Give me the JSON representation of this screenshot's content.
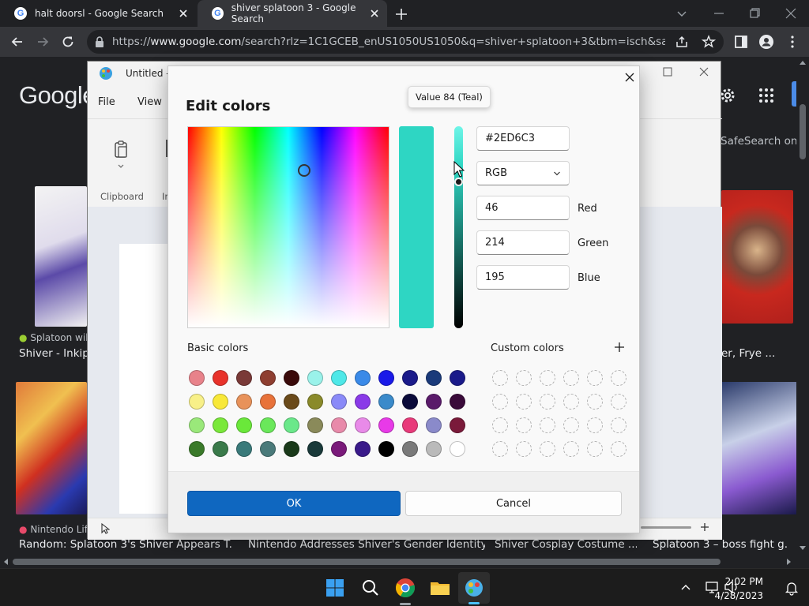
{
  "browser": {
    "tabs": [
      {
        "title": "halt doorsl - Google Search",
        "active": false
      },
      {
        "title": "shiver splatoon 3 - Google Search",
        "active": true
      }
    ],
    "url_prefix": "https://",
    "url_domain": "www.google.com",
    "url_rest": "/search?rlz=1C1GCEB_enUS1050US1050&q=shiver+splatoon+3&tbm=isch&sa=X&ved..."
  },
  "google": {
    "logo": "Google",
    "safesearch": "SafeSearch on",
    "results": [
      {
        "source": "Splatoon wik",
        "caption": "Shiver - Inkipe"
      },
      {
        "source": "",
        "caption": "er, Frye ..."
      },
      {
        "source": "Nintendo Life",
        "caption": "Random: Splatoon 3's Shiver Appears T..."
      },
      {
        "source": "",
        "caption": "Nintendo Addresses Shiver's Gender Identity"
      },
      {
        "source": "",
        "caption": "Shiver Cosplay Costume ..."
      },
      {
        "source": "",
        "caption": "Splatoon 3 – boss fight g..."
      }
    ]
  },
  "paint": {
    "title": "Untitled -",
    "menu": [
      "File",
      "View"
    ],
    "ribbon_group": "Clipboard",
    "ribbon_partial": "Ir"
  },
  "dialog": {
    "title": "Edit colors",
    "hex": "#2ED6C3",
    "mode": "RGB",
    "channels": [
      {
        "label": "Red",
        "value": "46"
      },
      {
        "label": "Green",
        "value": "214"
      },
      {
        "label": "Blue",
        "value": "195"
      }
    ],
    "current_color": "#2ED6C3",
    "value_level_percent": 84,
    "basic_label": "Basic colors",
    "custom_label": "Custom colors",
    "basic_colors": [
      "#E8828A",
      "#E8322A",
      "#7A3A38",
      "#8E3E30",
      "#3A0A0A",
      "#9AF2EA",
      "#4EE8E8",
      "#3A8AE8",
      "#1A1AE8",
      "#1A1A8A",
      "#1A3A7A",
      "#1A1A8A",
      "#F8F088",
      "#F8E838",
      "#E8925A",
      "#E8723A",
      "#6A4A1A",
      "#8A8A2A",
      "#8A8AF8",
      "#8A3AE8",
      "#3A8ACA",
      "#0A0A3A",
      "#5A1A6A",
      "#3A0A3A",
      "#9AE87A",
      "#7AE83A",
      "#6AE83A",
      "#6AE85A",
      "#6AE88A",
      "#8A8A5A",
      "#E88AAA",
      "#E88AE8",
      "#E83AE8",
      "#E83A7A",
      "#8A8ACA",
      "#7A1A3A",
      "#3A7A2A",
      "#3A7A4A",
      "#3A7A7A",
      "#4A7A7A",
      "#1A3A1A",
      "#1A3A3A",
      "#7A1A7A",
      "#3A1A8A",
      "#000000",
      "#7A7A7A",
      "#BABABA",
      "#FFFFFF"
    ],
    "custom_colors_count": 24,
    "ok": "OK",
    "cancel": "Cancel"
  },
  "tooltip": "Value 84 (Teal)",
  "taskbar": {
    "time": "2:02 PM",
    "date": "4/28/2023"
  }
}
